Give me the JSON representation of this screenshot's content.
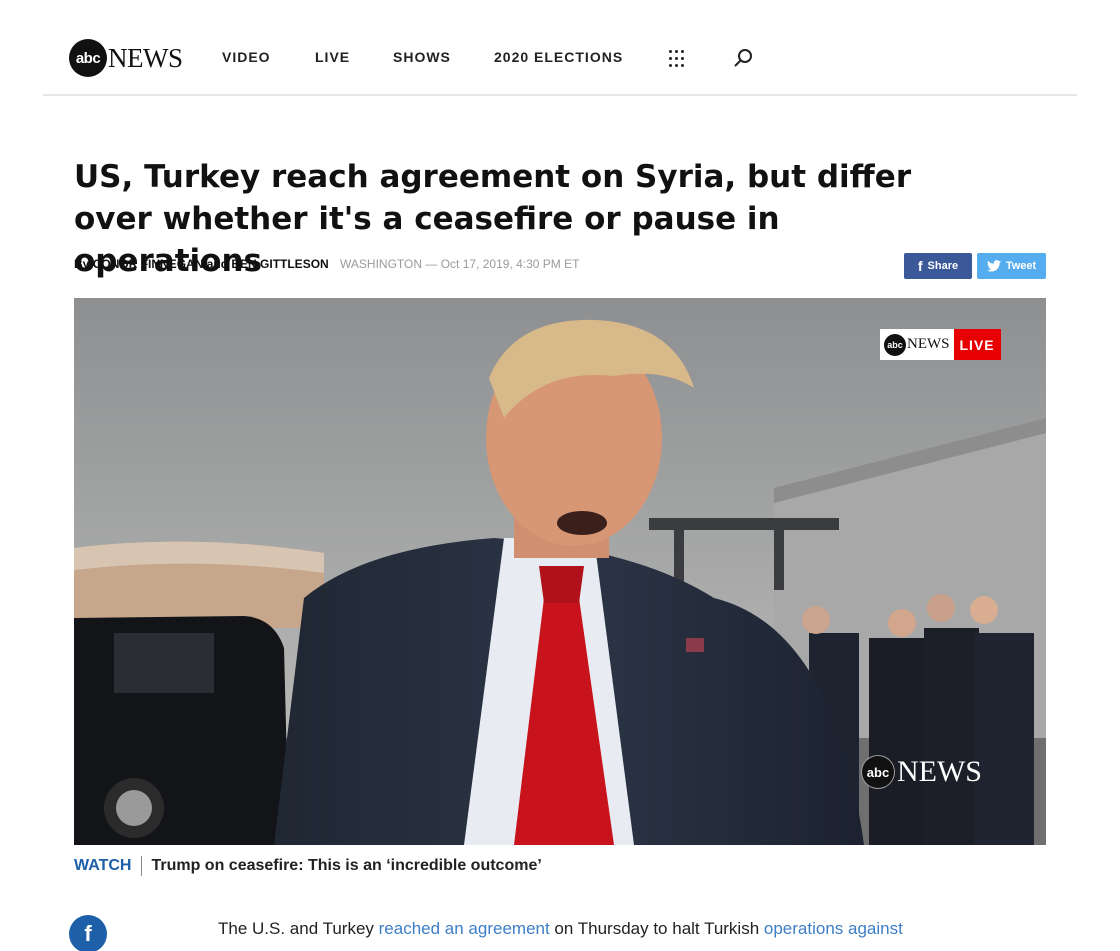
{
  "header": {
    "logo_abc": "abc",
    "logo_news": "NEWS",
    "nav": [
      "VIDEO",
      "LIVE",
      "SHOWS",
      "2020 ELECTIONS"
    ],
    "icons": [
      "apps-grid-icon",
      "search-icon"
    ]
  },
  "article": {
    "headline": "US, Turkey reach agreement on Syria, but differ over whether it's a ceasefire or pause in operations",
    "by": "By",
    "authors": "CONOR FINNEGAN and BEN GITTLESON",
    "dateline": "WASHINGTON — Oct 17, 2019, 4:30 PM ET",
    "share": {
      "facebook": "Share",
      "twitter": "Tweet"
    }
  },
  "video": {
    "badge_abc": "abc",
    "badge_news": "NEWS",
    "badge_live": "LIVE",
    "bug_abc": "abc",
    "bug_news": "NEWS"
  },
  "caption": {
    "watch": "WATCH",
    "title": "Trump on ceasefire: This is an ‘incredible outcome’"
  },
  "body": {
    "p1_start": "The U.S. and Turkey ",
    "link1": "reached an agreement",
    "p1_mid": " on Thursday to halt Turkish ",
    "link2": "operations against"
  },
  "colors": {
    "facebook": "#3b5998",
    "twitter": "#55acee",
    "link": "#3d7ec7",
    "watch": "#1d5fa8",
    "live": "#e60000"
  }
}
